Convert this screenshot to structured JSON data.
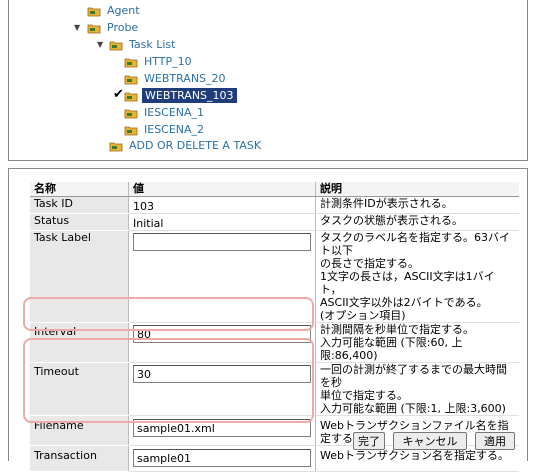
{
  "tree": {
    "items": [
      {
        "label": "Agent"
      },
      {
        "label": "Probe"
      },
      {
        "label": "Task List"
      },
      {
        "label": "HTTP_10"
      },
      {
        "label": "WEBTRANS_20"
      },
      {
        "label": "WEBTRANS_103"
      },
      {
        "label": "IESCENA_1"
      },
      {
        "label": "IESCENA_2"
      },
      {
        "label": "ADD OR DELETE A TASK"
      }
    ],
    "expand_glyph": "▼",
    "check_glyph": "✔"
  },
  "table": {
    "headers": {
      "name": "名称",
      "value": "値",
      "desc": "説明"
    },
    "rows": [
      {
        "name": "Task ID",
        "value": "103",
        "desc": [
          "計測条件IDが表示される。"
        ]
      },
      {
        "name": "Status",
        "value": "Initial",
        "desc": [
          "タスクの状態が表示される。"
        ]
      },
      {
        "name": "Task Label",
        "value": "",
        "desc": [
          "タスクのラベル名を指定する。63バイト以下",
          "の長さで指定する。",
          "1文字の長さは，ASCII文字は1バイト，",
          "ASCII文字以外は2バイトである。",
          "(オプション項目)"
        ]
      },
      {
        "name": "Interval",
        "value": "80",
        "desc": [
          "計測間隔を秒単位で指定する。",
          "入力可能な範囲 (下限:60, 上限:86,400)"
        ]
      },
      {
        "name": "Timeout",
        "value": "30",
        "desc": [
          "一回の計測が終了するまでの最大時間を秒",
          "単位で指定する。",
          "入力可能な範囲 (下限:1, 上限:3,600)"
        ]
      },
      {
        "name": "Filename",
        "value": "sample01.xml",
        "desc": [
          "Webトランザクションファイル名を指定する。"
        ]
      },
      {
        "name": "Transaction",
        "value": "sample01",
        "desc": [
          "Webトランザクション名を指定する。"
        ]
      }
    ]
  },
  "buttons": {
    "finish": "完了",
    "cancel": "キャンセル",
    "apply": "適用"
  },
  "colors": {
    "link": "#2a6fa8",
    "selected_bg": "#1f3d7a",
    "highlight": "#f0a8a8",
    "folder": "#e8b23a"
  }
}
